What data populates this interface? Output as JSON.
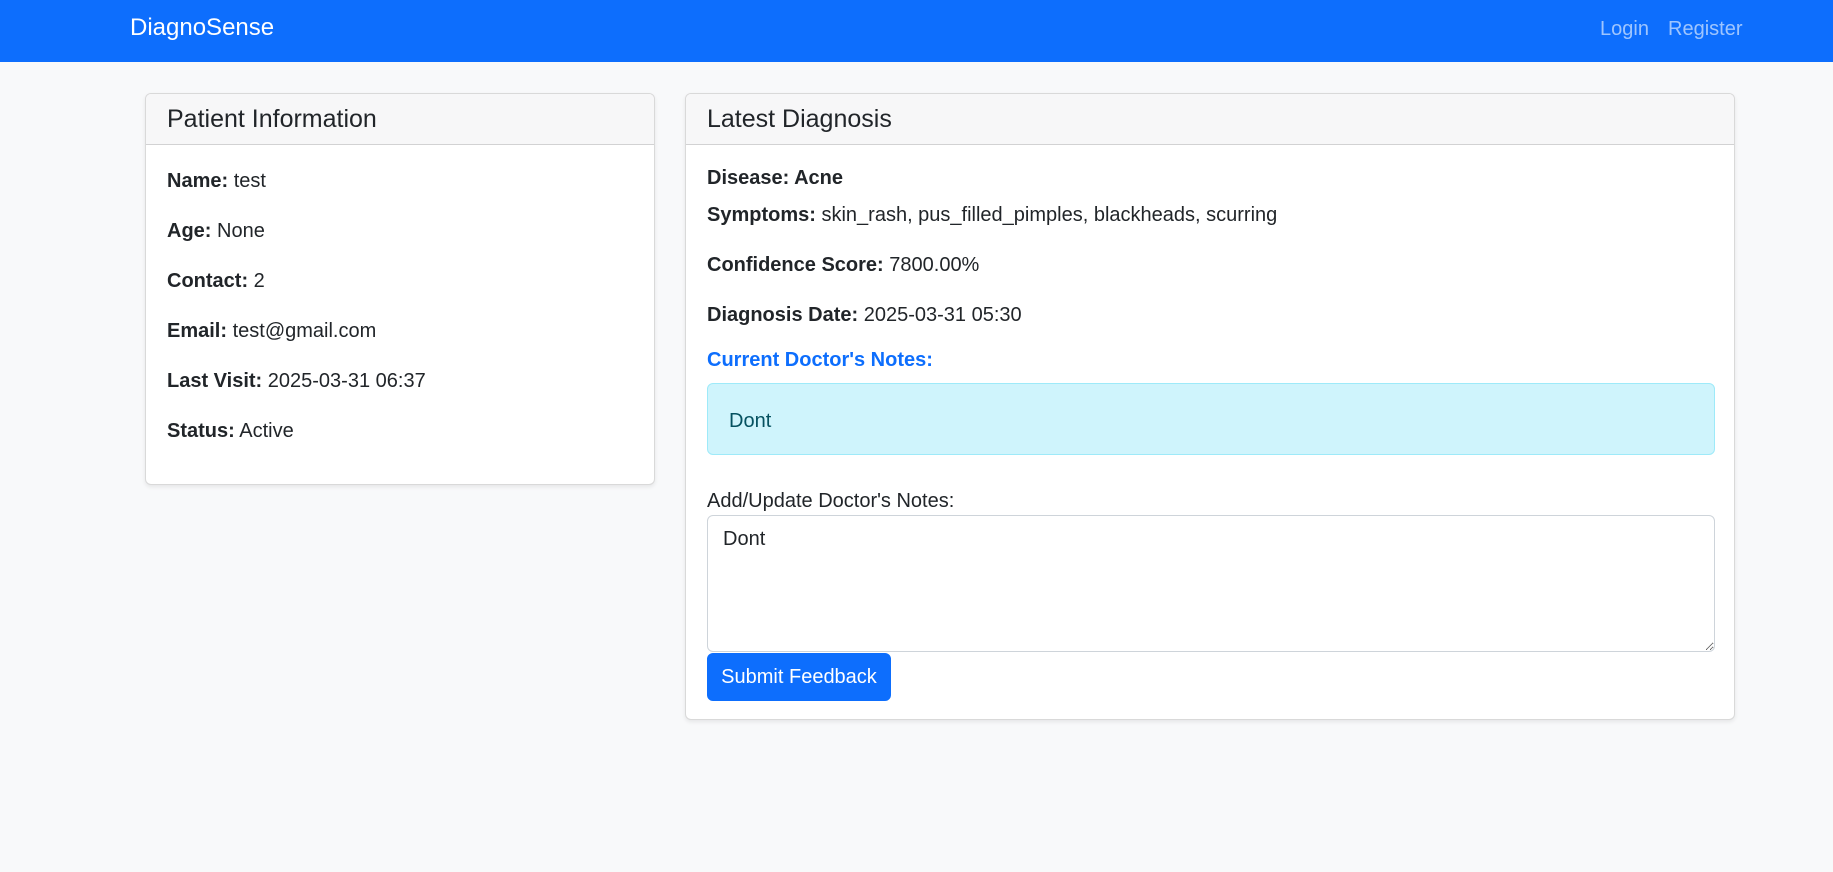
{
  "navbar": {
    "brand": "DiagnoSense",
    "links": [
      "Login",
      "Register"
    ],
    "background_color": "#0d6efd"
  },
  "patient_card": {
    "title": "Patient Information",
    "fields": [
      {
        "label": "Name:",
        "value": "test"
      },
      {
        "label": "Age:",
        "value": "None"
      },
      {
        "label": "Contact:",
        "value": "2"
      },
      {
        "label": "Email:",
        "value": "test@gmail.com"
      },
      {
        "label": "Last Visit:",
        "value": "2025-03-31 06:37"
      },
      {
        "label": "Status:",
        "value": "Active"
      }
    ]
  },
  "diagnosis_card": {
    "title": "Latest Diagnosis",
    "disease_label": "Disease:",
    "disease_value": "Acne",
    "symptoms_label": "Symptoms:",
    "symptoms_value": "skin_rash, pus_filled_pimples, blackheads, scurring",
    "confidence_label": "Confidence Score:",
    "confidence_value": "7800.00%",
    "date_label": "Diagnosis Date:",
    "date_value": "2025-03-31 05:30",
    "current_notes_heading": "Current Doctor's Notes:",
    "current_notes": "Dont",
    "form_label": "Add/Update Doctor's Notes:",
    "textarea_value": "Dont",
    "submit_label": "Submit Feedback",
    "accent_color": "#0d6efd",
    "notes_alert_color": "#cff4fc"
  }
}
